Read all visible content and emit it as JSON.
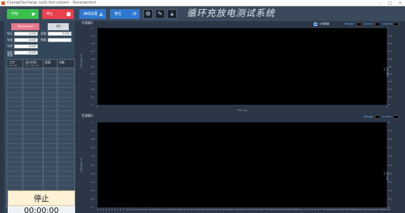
{
  "window": {
    "title": "ChargeDischarge cycle test system - Development"
  },
  "toolbar": {
    "start_label": "开始",
    "stop_label": "停止",
    "graph_settings_label": "曲线设置",
    "reset_label": "复位"
  },
  "app_title": "循环充放电测试系统",
  "left": {
    "disconnect_label": "Disconnect",
    "off_label": "Off",
    "fields": [
      {
        "label": "电压",
        "value": "0.000"
      },
      {
        "label": "电流",
        "value": "0.000"
      },
      {
        "label": "功率",
        "value": "0.000"
      },
      {
        "label": "电阻",
        "value": "0.000"
      },
      {
        "label": "状态",
        "value": ""
      }
    ],
    "right_fields": [
      {
        "label": "容量",
        "value": "0.000"
      },
      {
        "label": "能量",
        "value": ""
      }
    ],
    "table": {
      "headers": [
        "工步",
        "运行时间",
        "容量",
        "功能"
      ],
      "subheaders": [
        "Change",
        "HH : MM : SS"
      ]
    },
    "stop_status": "停止",
    "timer": "00:00:00"
  },
  "chart1": {
    "title": "示波器2",
    "record_label": "记录数据",
    "legend": [
      "Voltage",
      "Current",
      "Capacity"
    ],
    "y_ticks": [
      "1",
      "0.9",
      "0.8",
      "0.7",
      "0.6",
      "0.5",
      "0.4",
      "0.3",
      "0.2",
      "0.1",
      "0"
    ],
    "x_ticks": [
      "0",
      "1"
    ],
    "xlabel": "Time (s)",
    "ylabel": "Voltage (V)"
  },
  "chart2": {
    "title": "示波器3",
    "legend": [
      "Voltage",
      "Current"
    ],
    "y_ticks": [
      "1",
      "0.9",
      "0.8",
      "0.7",
      "0.6",
      "0.5",
      "0.4",
      "0.3",
      "0.2",
      "0.1",
      "0"
    ],
    "ylabel": "Voltage (V)",
    "x_ticks": [
      "0",
      "1",
      "2",
      "3",
      "4",
      "5",
      "6",
      "7",
      "8",
      "9",
      "10",
      "11",
      "12",
      "13",
      "14",
      "15",
      "16",
      "17",
      "18",
      "19",
      "20",
      "21",
      "22",
      "23",
      "24",
      "25",
      "26",
      "27",
      "28",
      "29",
      "30",
      "31",
      "32",
      "33",
      "34",
      "35",
      "36",
      "37",
      "38",
      "39",
      "40",
      "41",
      "42",
      "43",
      "44",
      "45",
      "46",
      "47",
      "48",
      "49",
      "50",
      "51",
      "52",
      "53",
      "54",
      "55",
      "56",
      "57",
      "58",
      "59",
      "60",
      "61",
      "62",
      "63",
      "64",
      "65",
      "66",
      "67",
      "68",
      "69",
      "70",
      "71",
      "72",
      "73",
      "74",
      "75",
      "76",
      "77",
      "78",
      "79",
      "80",
      "81",
      "82",
      "83",
      "84",
      "85",
      "86",
      "87",
      "88",
      "89",
      "90",
      "91",
      "92",
      "93",
      "94",
      "95",
      "96",
      "97",
      "98",
      "99",
      "100"
    ]
  },
  "colors": {
    "start": "#3cc04e",
    "stop": "#e8404c",
    "accent": "#2f78d0"
  }
}
